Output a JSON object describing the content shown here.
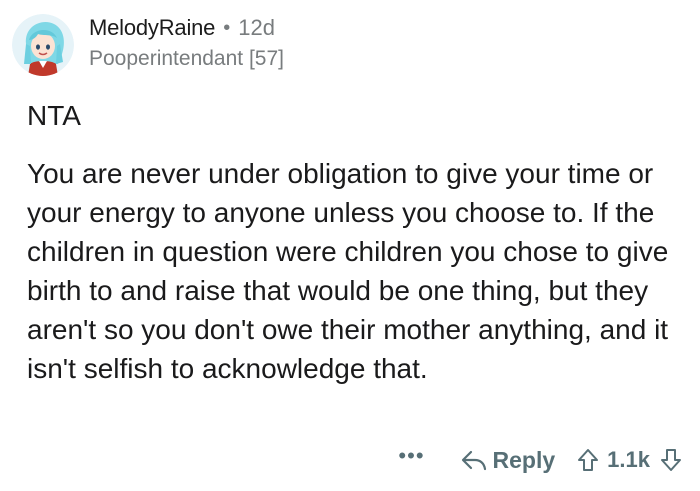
{
  "comment": {
    "author": "MelodyRaine",
    "separator": "•",
    "age": "12d",
    "flair": "Pooperintendant [57]",
    "paragraphs": [
      "NTA",
      "You are never under obligation to give your time or your energy to anyone unless you choose to.  If the children in question were children you chose to give birth to and raise that would be one thing, but they aren't so you don't owe their mother anything, and it isn't selfish to acknowledge that."
    ],
    "actions": {
      "more_label": "•••",
      "reply_label": "Reply",
      "score": "1.1k"
    }
  },
  "icons": {
    "avatar": "avatar-icon",
    "reply": "reply-arrow-icon",
    "upvote": "upvote-arrow-icon",
    "downvote": "downvote-arrow-icon"
  },
  "colors": {
    "text": "#1a1a1b",
    "meta": "#787c7e",
    "action": "#576f76",
    "avatar_hair": "#7fd8e6",
    "avatar_bg": "#d9eef7"
  }
}
